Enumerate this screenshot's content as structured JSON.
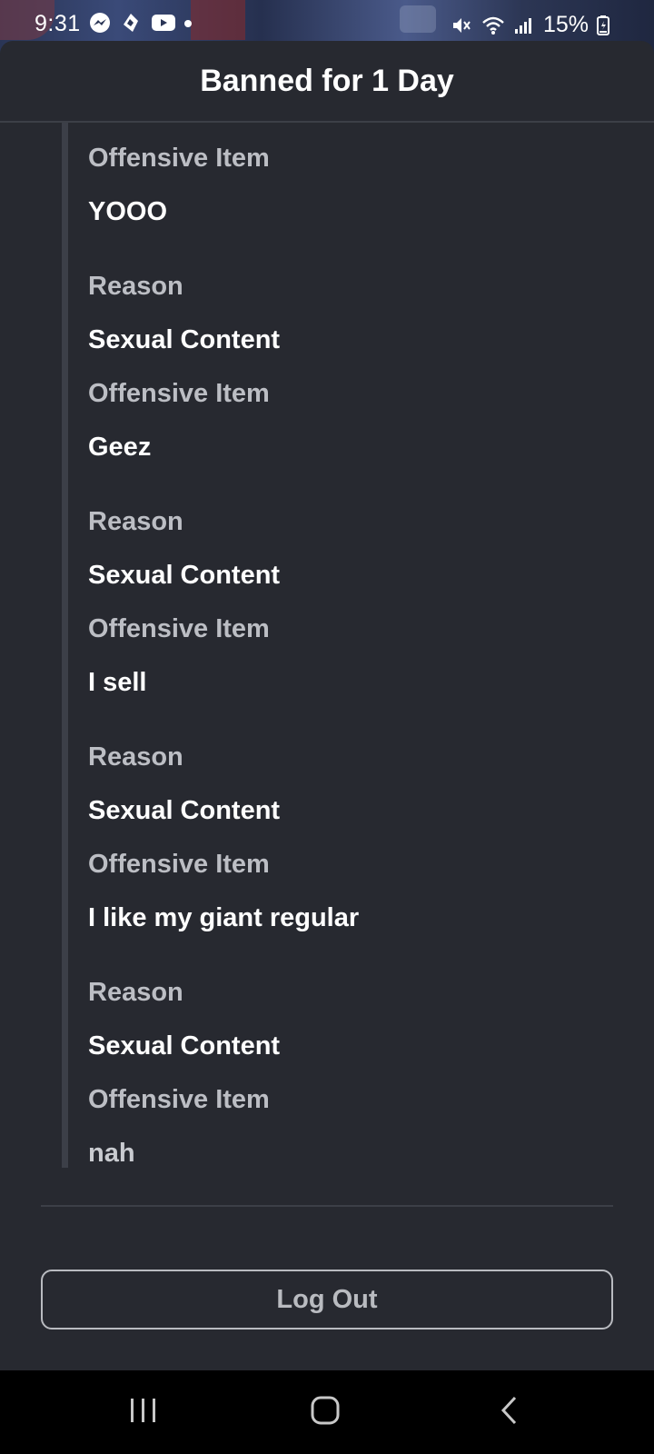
{
  "status_bar": {
    "time": "9:31",
    "battery": "15%",
    "left_icons": [
      "messenger-icon",
      "app-icon",
      "youtube-icon",
      "dot-icon"
    ],
    "right_icons": [
      "mute-icon",
      "wifi-icon",
      "signal-icon",
      "battery-icon"
    ]
  },
  "dialog": {
    "title": "Banned for 1 Day",
    "entries": [
      {
        "label": "Offensive Item",
        "value": "YOOO"
      },
      {
        "label": "Reason",
        "value": "Sexual Content"
      },
      {
        "label": "Offensive Item",
        "value": "Geez"
      },
      {
        "label": "Reason",
        "value": "Sexual Content"
      },
      {
        "label": "Offensive Item",
        "value": "I sell"
      },
      {
        "label": "Reason",
        "value": "Sexual Content"
      },
      {
        "label": "Offensive Item",
        "value": "I like my giant regular"
      },
      {
        "label": "Reason",
        "value": "Sexual Content"
      },
      {
        "label": "Offensive Item",
        "value": "nah"
      }
    ],
    "logout_label": "Log Out"
  },
  "nav_bar": {
    "icons": [
      "recent-apps-icon",
      "home-icon",
      "back-icon"
    ]
  },
  "colors": {
    "sheet_background": "#272930",
    "primary_text": "#ffffff",
    "secondary_text": "#bcbec4",
    "button_outline": "#b9bbc0"
  }
}
